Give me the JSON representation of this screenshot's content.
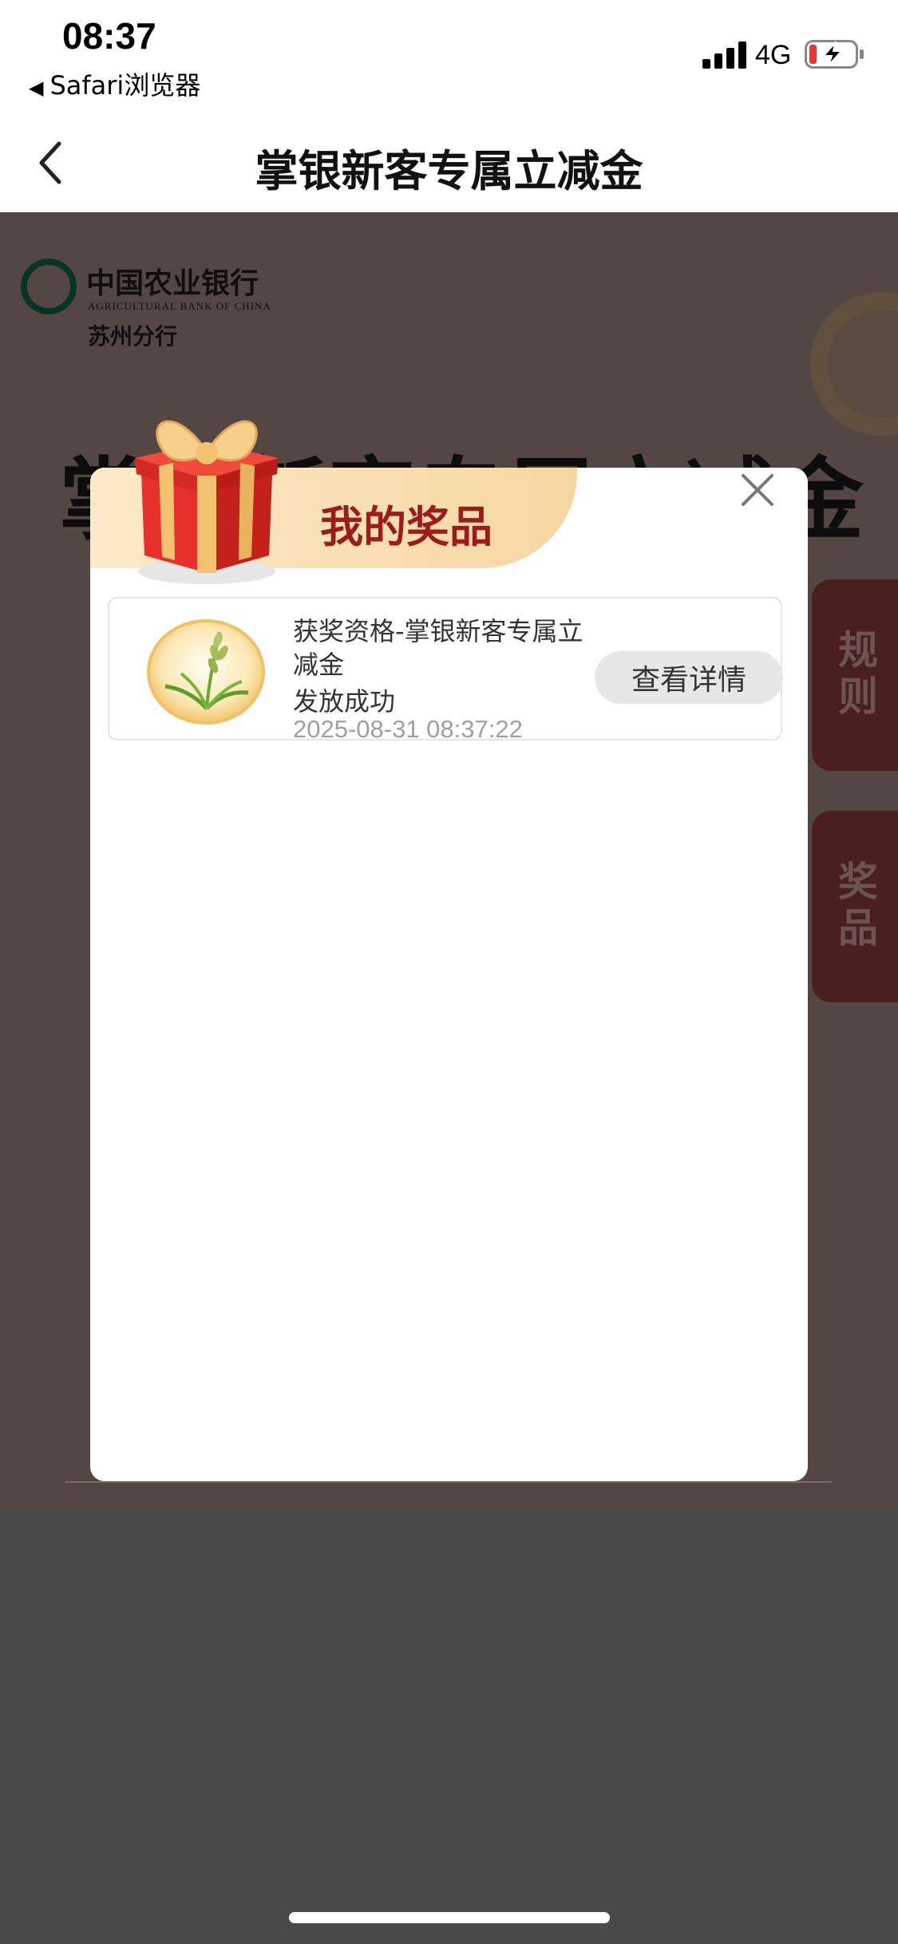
{
  "status_bar": {
    "time": "08:37",
    "back_app": "Safari浏览器",
    "network": "4G",
    "battery_color": "#e53935"
  },
  "nav": {
    "title": "掌银新客专属立减金"
  },
  "background_page": {
    "bank_name": "中国农业银行",
    "bank_name_en": "AGRICULTURAL BANK OF CHINA",
    "bank_branch": "苏州分行",
    "heading": "掌银新客专属立减金",
    "side_tabs": {
      "rules": "规则",
      "prizes": "奖品"
    }
  },
  "modal": {
    "title": "我的奖品",
    "prizes": [
      {
        "name": "获奖资格-掌银新客专属立减金",
        "status": "发放成功",
        "time": "2025-08-31 08:37:22",
        "button": "查看详情"
      }
    ]
  },
  "colors": {
    "accent_red": "#9c1c1c",
    "header_gold": "#f6d7a2",
    "bank_green": "#0c6a4e"
  }
}
